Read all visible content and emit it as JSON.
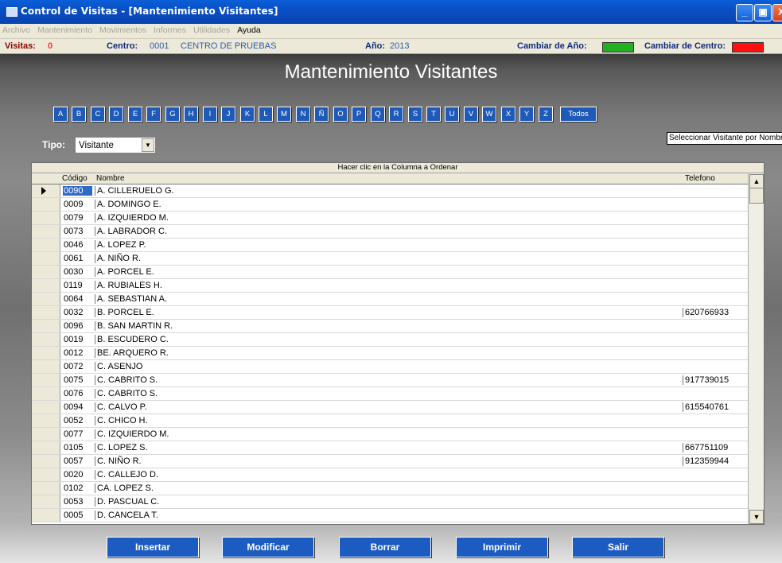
{
  "window": {
    "title": "Control de Visitas - [Mantenimiento Visitantes]",
    "buttons": [
      "_",
      "▣",
      "X"
    ]
  },
  "menu": [
    "Archivo",
    "Mantenimiento",
    "Movimientos",
    "Informes",
    "Utilidades",
    "Ayuda"
  ],
  "info": {
    "visitas_label": "Visitas:",
    "visitas_value": "0",
    "centro_label": "Centro:",
    "centro_code": "0001",
    "centro_name": "CENTRO DE PRUEBAS",
    "anio_label": "Año:",
    "anio_value": "2013",
    "cambiar_anio_label": "Cambiar de Año:",
    "cambiar_anio_color": "#22b022",
    "cambiar_centro_label": "Cambiar de Centro:",
    "cambiar_centro_color": "#ff1010"
  },
  "page_title": "Mantenimiento Visitantes",
  "letters": [
    "A",
    "B",
    "C",
    "D",
    "E",
    "F",
    "G",
    "H",
    "I",
    "J",
    "K",
    "L",
    "M",
    "N",
    "Ñ",
    "O",
    "P",
    "Q",
    "R",
    "S",
    "T",
    "U",
    "V",
    "W",
    "X",
    "Y",
    "Z"
  ],
  "letters_all": "Todos",
  "tipo": {
    "label": "Tipo:",
    "selected": "Visitante"
  },
  "hint": "Seleccionar Visitante por Nombre",
  "grid": {
    "caption": "Hacer clic en la Columna a Ordenar",
    "columns": [
      "Código",
      "Nombre",
      "Telefono"
    ],
    "rows": [
      {
        "code": "0090",
        "name": "A. CILLERUELO G.",
        "tel": ""
      },
      {
        "code": "0009",
        "name": "A. DOMINGO E.",
        "tel": ""
      },
      {
        "code": "0079",
        "name": "A. IZQUIERDO M.",
        "tel": ""
      },
      {
        "code": "0073",
        "name": "A. LABRADOR C.",
        "tel": ""
      },
      {
        "code": "0046",
        "name": "A. LOPEZ P.",
        "tel": ""
      },
      {
        "code": "0061",
        "name": "A. NIÑO R.",
        "tel": ""
      },
      {
        "code": "0030",
        "name": "A. PORCEL E.",
        "tel": ""
      },
      {
        "code": "0119",
        "name": "A. RUBIALES H.",
        "tel": ""
      },
      {
        "code": "0064",
        "name": "A. SEBASTIAN A.",
        "tel": ""
      },
      {
        "code": "0032",
        "name": "B. PORCEL E.",
        "tel": "620766933"
      },
      {
        "code": "0096",
        "name": "B. SAN MARTIN R.",
        "tel": ""
      },
      {
        "code": "0019",
        "name": "B. ESCUDERO C.",
        "tel": ""
      },
      {
        "code": "0012",
        "name": "BE. ARQUERO R.",
        "tel": ""
      },
      {
        "code": "0072",
        "name": "C. ASENJO",
        "tel": ""
      },
      {
        "code": "0075",
        "name": "C. CABRITO S.",
        "tel": "917739015"
      },
      {
        "code": "0076",
        "name": "C. CABRITO S.",
        "tel": ""
      },
      {
        "code": "0094",
        "name": "C. CALVO P.",
        "tel": "615540761"
      },
      {
        "code": "0052",
        "name": "C. CHICO H.",
        "tel": ""
      },
      {
        "code": "0077",
        "name": "C. IZQUIERDO M.",
        "tel": ""
      },
      {
        "code": "0105",
        "name": "C. LOPEZ S.",
        "tel": "667751109"
      },
      {
        "code": "0057",
        "name": "C. NIÑO R.",
        "tel": "912359944"
      },
      {
        "code": "0020",
        "name": "C. CALLEJO D.",
        "tel": ""
      },
      {
        "code": "0102",
        "name": "CA. LOPEZ S.",
        "tel": ""
      },
      {
        "code": "0053",
        "name": "D. PASCUAL C.",
        "tel": ""
      },
      {
        "code": "0005",
        "name": "D. CANCELA T.",
        "tel": ""
      }
    ]
  },
  "buttons": [
    "Insertar",
    "Modificar",
    "Borrar",
    "Imprimir",
    "Salir"
  ]
}
